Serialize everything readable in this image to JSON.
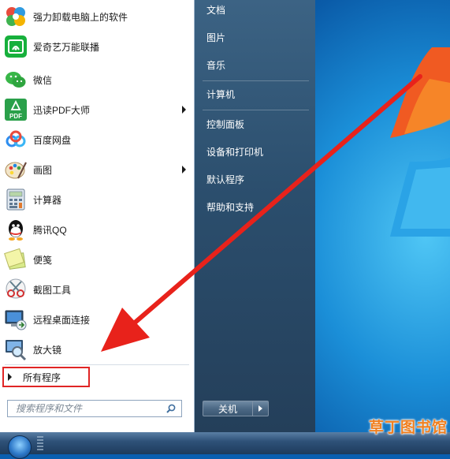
{
  "programs": [
    {
      "label": "强力卸载电脑上的软件",
      "icon": "uninstaller-icon",
      "has_submenu": false
    },
    {
      "label": "爱奇艺万能联播",
      "icon": "iqiyi-icon",
      "has_submenu": false
    },
    {
      "label": "微信",
      "icon": "wechat-icon",
      "has_submenu": false
    },
    {
      "label": "迅读PDF大师",
      "icon": "pdf-reader-icon",
      "has_submenu": true
    },
    {
      "label": "百度网盘",
      "icon": "baidu-netdisk-icon",
      "has_submenu": false
    },
    {
      "label": "画图",
      "icon": "paint-icon",
      "has_submenu": true
    },
    {
      "label": "计算器",
      "icon": "calculator-icon",
      "has_submenu": false
    },
    {
      "label": "腾讯QQ",
      "icon": "qq-icon",
      "has_submenu": false
    },
    {
      "label": "便笺",
      "icon": "sticky-notes-icon",
      "has_submenu": false
    },
    {
      "label": "截图工具",
      "icon": "snipping-tool-icon",
      "has_submenu": false
    },
    {
      "label": "远程桌面连接",
      "icon": "remote-desktop-icon",
      "has_submenu": false
    },
    {
      "label": "放大镜",
      "icon": "magnifier-icon",
      "has_submenu": false
    }
  ],
  "pdf_icon_text": "PDF",
  "all_programs": "所有程序",
  "search": {
    "placeholder": "搜索程序和文件"
  },
  "right_pane": {
    "items": [
      "文档",
      "图片",
      "音乐",
      "计算机",
      "控制面板",
      "设备和打印机",
      "默认程序",
      "帮助和支持"
    ]
  },
  "shutdown": {
    "label": "关机"
  },
  "watermark": "草丁图书馆",
  "colors": {
    "highlight_box": "#e02525",
    "arrow": "#e8221b",
    "watermark": "#f08020"
  }
}
